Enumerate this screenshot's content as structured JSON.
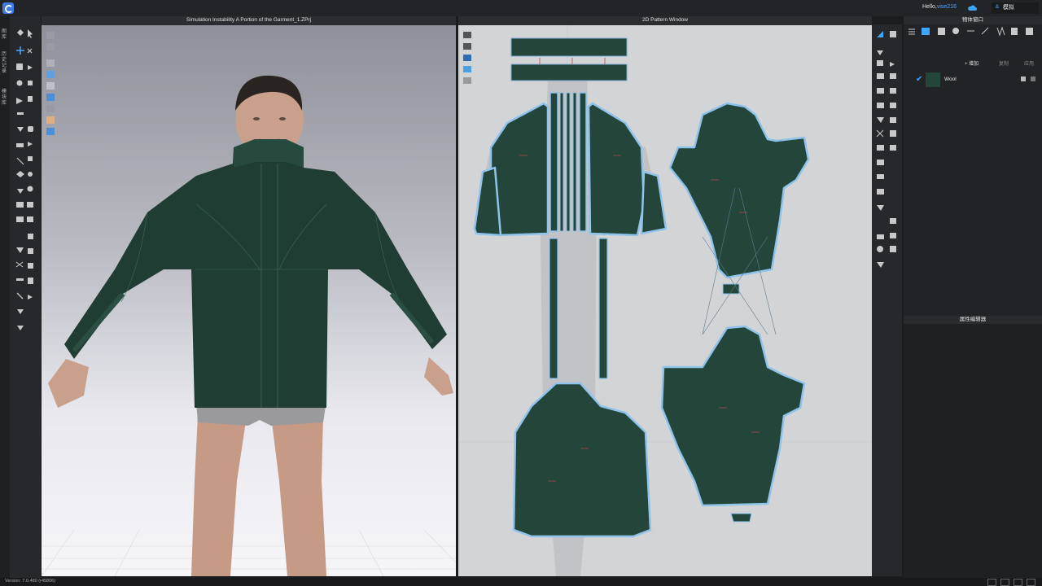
{
  "topbar": {
    "hello_prefix": "Hello,",
    "username": "vise216",
    "mode_label": "模拟"
  },
  "left_tabs": [
    "图库",
    "历史记录",
    "模块库"
  ],
  "view3d": {
    "title": "Simulation Instability A Portion of the Garment_1.ZPrj"
  },
  "view2d": {
    "title": "2D Pattern Window"
  },
  "object_window": {
    "title": "物体窗口",
    "add_label": "+ 增加",
    "copy_label": "复制",
    "apply_label": "应用",
    "fabric": {
      "name": "Wool",
      "color": "#23453a",
      "checked": true
    }
  },
  "property_editor": {
    "title": "属性编辑器"
  },
  "status": {
    "version": "Version: 7.0.480 (r45806)"
  },
  "colors": {
    "accent": "#3ea6ff",
    "fabric": "#23453a",
    "pattern_outline": "#8fc3ea"
  }
}
